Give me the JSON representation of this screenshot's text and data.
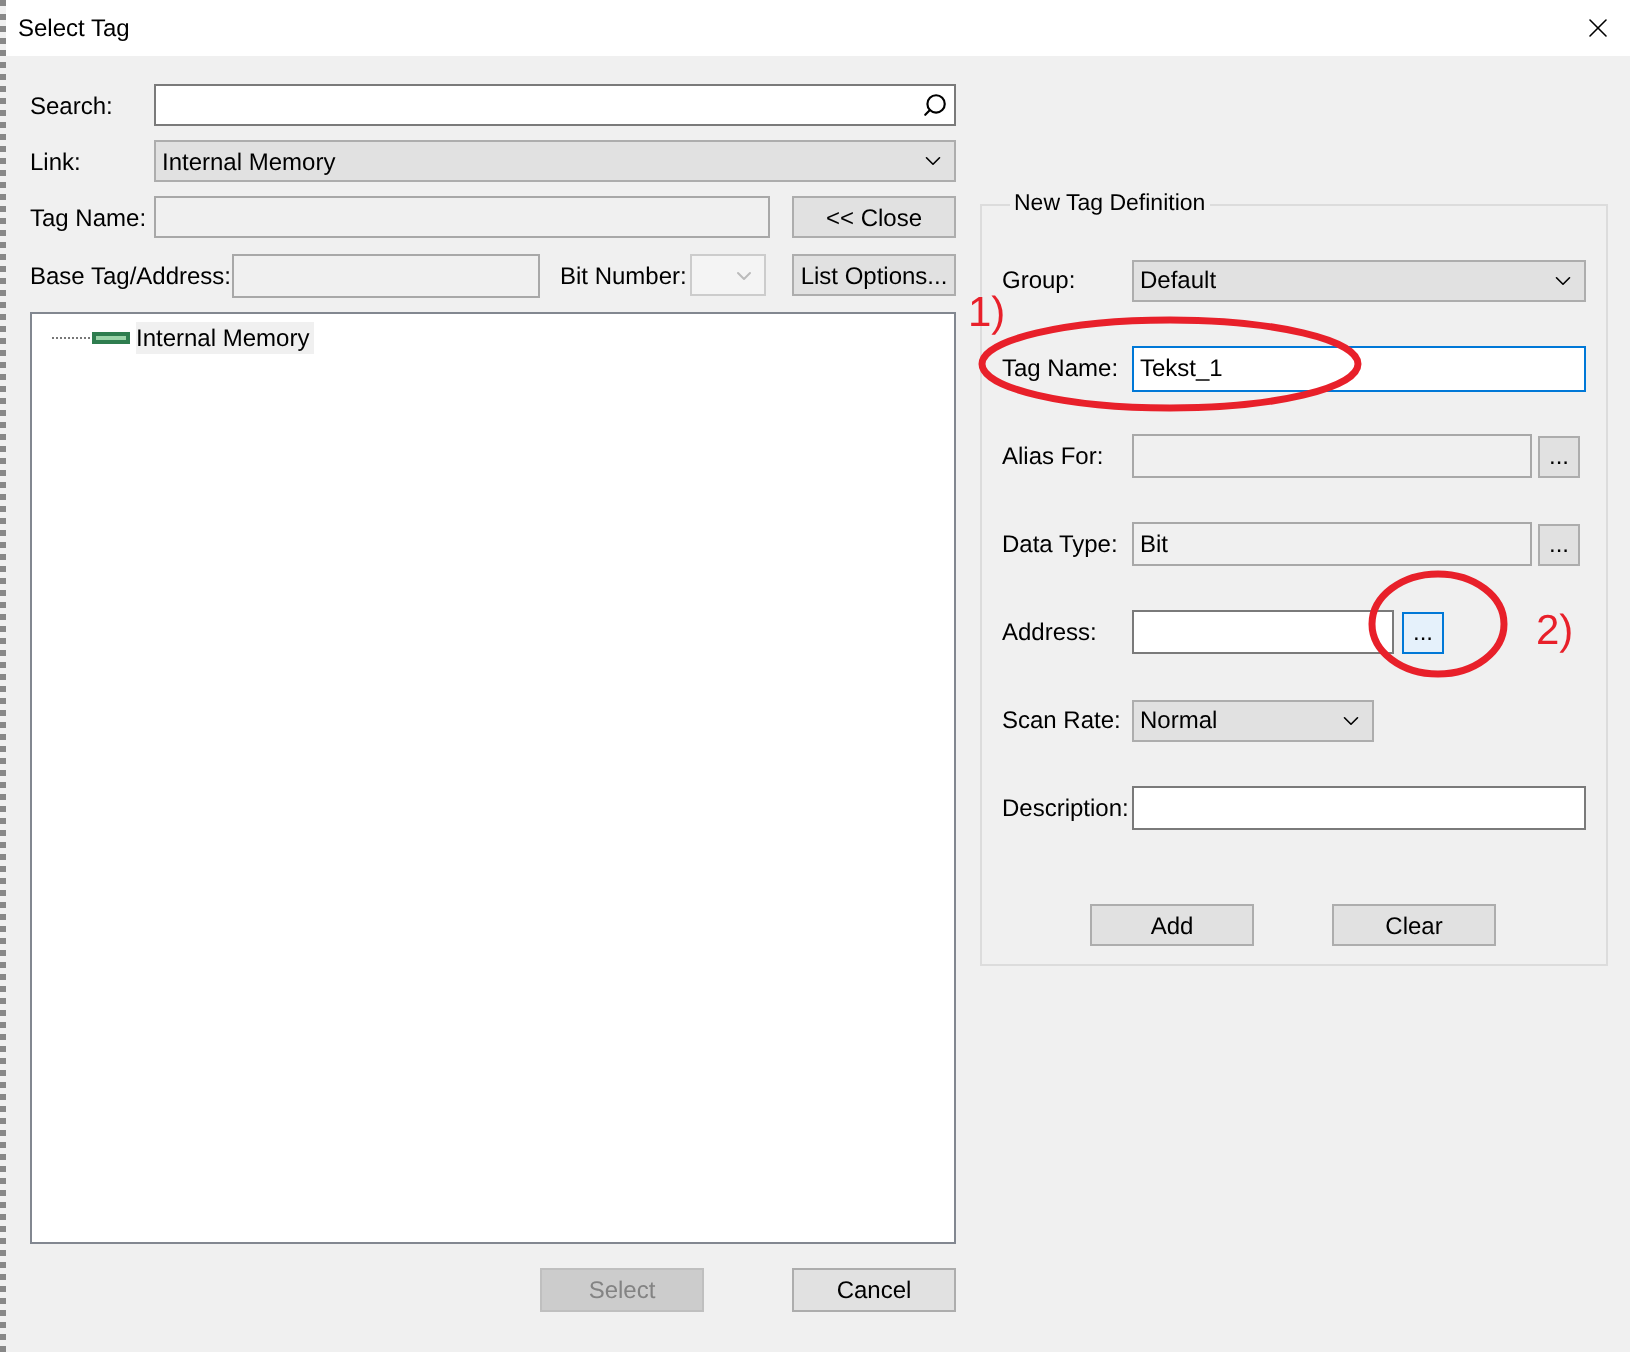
{
  "window": {
    "title": "Select Tag"
  },
  "search": {
    "label": "Search:"
  },
  "link": {
    "label": "Link:",
    "value": "Internal Memory"
  },
  "tag_name": {
    "label": "Tag Name:",
    "disabled": true
  },
  "close_button": {
    "label": "<< Close"
  },
  "base_tag": {
    "label": "Base Tag/Address:",
    "disabled": true
  },
  "bit_number": {
    "label": "Bit Number:",
    "disabled": true
  },
  "list_options_button": {
    "label": "List Options..."
  },
  "tree": [
    {
      "label": "Internal Memory",
      "selected": true
    }
  ],
  "buttons": [
    {
      "label": "Select",
      "disabled": true
    },
    {
      "label": "Cancel",
      "disabled": false
    }
  ],
  "definition": {
    "title": "New Tag Definition",
    "fields": [
      {
        "kind": "select",
        "label": "Group:",
        "value": "Default",
        "narrow": false
      },
      {
        "kind": "text",
        "label": "Tag Name:",
        "value": "Tekst_1",
        "focused": true,
        "narrow": false
      },
      {
        "kind": "browse",
        "label": "Alias For:",
        "disabled": true,
        "button": "...",
        "highlighted": false,
        "narrow": false
      },
      {
        "kind": "browse",
        "label": "Data Type:",
        "value": "Bit",
        "disabled": true,
        "button": "...",
        "highlighted": false,
        "narrow": false
      },
      {
        "kind": "browse",
        "label": "Address:",
        "disabled": false,
        "button": "...",
        "highlighted": true,
        "narrow": true
      },
      {
        "kind": "select",
        "label": "Scan Rate:",
        "value": "Normal",
        "narrow": true
      },
      {
        "kind": "text",
        "label": "Description:",
        "focused": false,
        "narrow": false
      }
    ],
    "buttons": [
      {
        "label": "Add"
      },
      {
        "label": "Clear"
      }
    ]
  },
  "annotations": [
    {
      "label": "1)"
    },
    {
      "label": "2)"
    }
  ]
}
